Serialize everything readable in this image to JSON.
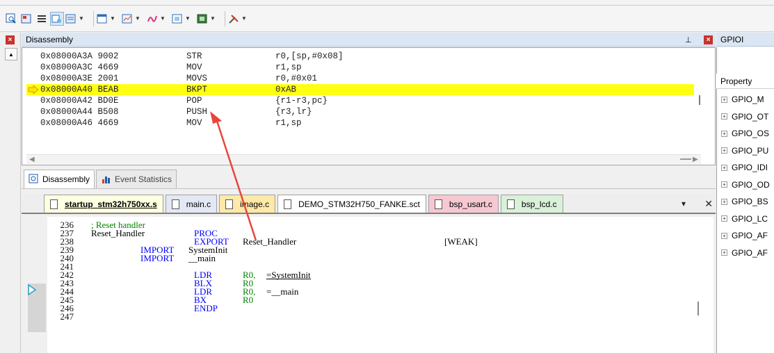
{
  "toolbar": {
    "buttons": [
      "disassembly-window-icon",
      "source-browser-icon",
      "call-stack-icon",
      "watch-icon",
      "memory-icon",
      "serial-icon",
      "analysis-icon",
      "trace-icon",
      "system-viewer-icon",
      "toolbox-icon",
      "tools-icon"
    ]
  },
  "disassembly": {
    "title": "Disassembly",
    "rows": [
      {
        "addr": "0x08000A3A 9002",
        "mn": "STR",
        "op": "r0,[sp,#0x08]",
        "current": false
      },
      {
        "addr": "0x08000A3C 4669",
        "mn": "MOV",
        "op": "r1,sp",
        "current": false
      },
      {
        "addr": "0x08000A3E 2001",
        "mn": "MOVS",
        "op": "r0,#0x01",
        "current": false
      },
      {
        "addr": "0x08000A40 BEAB",
        "mn": "BKPT",
        "op": "0xAB",
        "current": true
      },
      {
        "addr": "0x08000A42 BD0E",
        "mn": "POP",
        "op": "{r1-r3,pc}",
        "current": false
      },
      {
        "addr": "0x08000A44 B508",
        "mn": "PUSH",
        "op": "{r3,lr}",
        "current": false
      },
      {
        "addr": "0x08000A46 4669",
        "mn": "MOV",
        "op": "r1,sp",
        "current": false
      }
    ],
    "tabs": [
      "Disassembly",
      "Event Statistics"
    ]
  },
  "editor": {
    "tabs": [
      {
        "label": "startup_stm32h750xx.s",
        "color": "#ffffe1",
        "active": true
      },
      {
        "label": "main.c",
        "color": "#e4e8f4",
        "active": false
      },
      {
        "label": "image.c",
        "color": "#ffe9a8",
        "active": false
      },
      {
        "label": "DEMO_STM32H750_FANKE.sct",
        "color": "#ffffff",
        "active": false
      },
      {
        "label": "bsp_usart.c",
        "color": "#f6c8d2",
        "active": false
      },
      {
        "label": "bsp_lcd.c",
        "color": "#d9f0d9",
        "active": false
      }
    ],
    "lines": [
      {
        "n": "236",
        "text": "; Reset handler"
      },
      {
        "n": "237",
        "text": "Reset_Handler"
      },
      {
        "n": "238",
        "text": ""
      },
      {
        "n": "239",
        "text": ""
      },
      {
        "n": "240",
        "text": ""
      },
      {
        "n": "241",
        "text": ""
      },
      {
        "n": "242",
        "text": ""
      },
      {
        "n": "243",
        "text": ""
      },
      {
        "n": "244",
        "text": ""
      },
      {
        "n": "245",
        "text": ""
      },
      {
        "n": "246",
        "text": ""
      },
      {
        "n": "247",
        "text": ""
      }
    ],
    "tokens": {
      "proc": "PROC",
      "export": "EXPORT",
      "export_arg": "Reset_Handler",
      "weak": "[WEAK]",
      "import": "IMPORT",
      "systeminit": "SystemInit",
      "main": "__main",
      "ldr": "LDR",
      "blx": "BLX",
      "bx": "BX",
      "endp": "ENDP",
      "r0": "R0",
      "r0c": "R0,",
      "eq_systeminit": "=SystemInit",
      "eq_main": "=__main"
    }
  },
  "right_panel": {
    "title": "GPIOI",
    "property_label": "Property",
    "items": [
      "GPIO_M",
      "GPIO_OT",
      "GPIO_OS",
      "GPIO_PU",
      "GPIO_IDI",
      "GPIO_OD",
      "GPIO_BS",
      "GPIO_LC",
      "GPIO_AF",
      "GPIO_AF"
    ]
  }
}
